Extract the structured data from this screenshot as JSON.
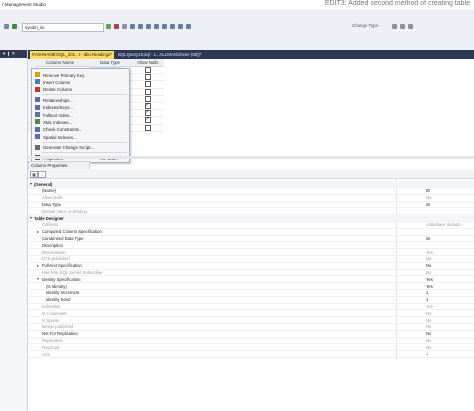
{
  "window": {
    "title": "r Management Studio",
    "overlay_text": "EDIT3: Added second method of creating table"
  },
  "toolbar": {
    "database_combo": "sysdm_iis",
    "change_type_label": "Change Type -"
  },
  "object_explorer": {
    "header": "▾ ❙ ✕"
  },
  "tabs": [
    {
      "label": "#VSHNAME\\SQL_201...t - dbo.Reading2*",
      "active": true,
      "close": "✕"
    },
    {
      "label": "SQLQuery10.sql - L...ALLMAN\\chene (56))*",
      "active": false
    }
  ],
  "table_designer": {
    "columns": [
      "Column Name",
      "Data Type",
      "Allow Nulls"
    ],
    "rows": [
      {
        "allow_nulls": false
      },
      {
        "allow_nulls": false
      },
      {
        "allow_nulls": false
      },
      {
        "allow_nulls": false
      },
      {
        "allow_nulls": false
      },
      {
        "allow_nulls": true
      },
      {
        "allow_nulls": true
      },
      {
        "allow_nulls": true
      },
      {
        "allow_nulls": false
      }
    ]
  },
  "context_menu": {
    "items": [
      {
        "label": "Remove Primary Key",
        "icon": "key-icon"
      },
      {
        "label": "Insert Column",
        "icon": "insert-column-icon"
      },
      {
        "label": "Delete Column",
        "icon": "delete-column-icon"
      },
      {
        "separator": true
      },
      {
        "label": "Relationships...",
        "icon": "relationships-icon"
      },
      {
        "label": "Indexes/Keys...",
        "icon": "indexes-icon"
      },
      {
        "label": "Fulltext Index...",
        "icon": "fulltext-icon"
      },
      {
        "label": "XML Indexes...",
        "icon": "xml-index-icon"
      },
      {
        "label": "Check Constraints...",
        "icon": "check-constraint-icon"
      },
      {
        "label": "Spatial Indexes...",
        "icon": "spatial-index-icon"
      },
      {
        "separator": true
      },
      {
        "label": "Generate Change Script...",
        "icon": "script-icon"
      },
      {
        "separator": true
      },
      {
        "label": "Properties",
        "icon": "wrench-icon",
        "shortcut": "Alt+Enter"
      }
    ]
  },
  "properties_panel": {
    "tab_label": "Column Properties",
    "rows": [
      {
        "label": "(General)",
        "value": "",
        "kind": "cat"
      },
      {
        "label": "(Name)",
        "value": "ID",
        "kind": "sub"
      },
      {
        "label": "Allow Nulls",
        "value": "No",
        "kind": "sub dim"
      },
      {
        "label": "Data Type",
        "value": "int",
        "kind": "sub"
      },
      {
        "label": "Default Value or Binding",
        "value": "",
        "kind": "sub dim"
      },
      {
        "label": "Table Designer",
        "value": "",
        "kind": "cat"
      },
      {
        "label": "Collation",
        "value": "<database default>",
        "kind": "sub dim"
      },
      {
        "label": "Computed Column Specification",
        "value": "",
        "kind": "sub"
      },
      {
        "label": "Condensed Data Type",
        "value": "int",
        "kind": "sub"
      },
      {
        "label": "Description",
        "value": "",
        "kind": "sub"
      },
      {
        "label": "Deterministic",
        "value": "Yes",
        "kind": "sub dim"
      },
      {
        "label": "DTS-published",
        "value": "No",
        "kind": "sub dim"
      },
      {
        "label": "Full-text Specification",
        "value": "No",
        "kind": "sub"
      },
      {
        "label": "Has Non-SQL Server Subscriber",
        "value": "No",
        "kind": "sub dim"
      },
      {
        "label": "Identity Specification",
        "value": "Yes",
        "kind": "sub"
      },
      {
        "label": "(Is Identity)",
        "value": "Yes",
        "kind": "sub2"
      },
      {
        "label": "Identity Increment",
        "value": "1",
        "kind": "sub2"
      },
      {
        "label": "Identity Seed",
        "value": "1",
        "kind": "sub2"
      },
      {
        "label": "Indexable",
        "value": "Yes",
        "kind": "sub dim"
      },
      {
        "label": "Is Columnset",
        "value": "No",
        "kind": "sub dim"
      },
      {
        "label": "Is Sparse",
        "value": "No",
        "kind": "sub dim"
      },
      {
        "label": "Merge-published",
        "value": "No",
        "kind": "sub dim"
      },
      {
        "label": "Not For Replication",
        "value": "No",
        "kind": "sub"
      },
      {
        "label": "Replicated",
        "value": "No",
        "kind": "sub dim"
      },
      {
        "label": "RowGuid",
        "value": "No",
        "kind": "sub dim"
      },
      {
        "label": "Size",
        "value": "4",
        "kind": "sub dim"
      }
    ]
  }
}
